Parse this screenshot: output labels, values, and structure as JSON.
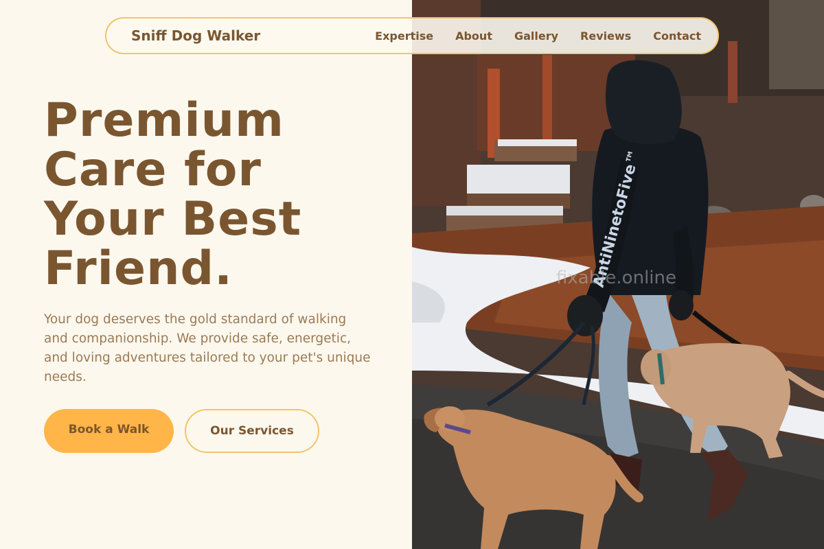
{
  "nav": {
    "brand": "Sniff Dog Walker",
    "links": [
      "Expertise",
      "About",
      "Gallery",
      "Reviews",
      "Contact"
    ]
  },
  "hero": {
    "headline_lines": [
      "Premium",
      "Care for",
      "Your Best",
      "Friend."
    ],
    "subtext": "Your dog deserves the gold standard of walking and companionship. We provide safe, energetic, and loving adventures tailored to your pet's unique needs.",
    "primary_button": "Book a Walk",
    "secondary_button": "Our Services"
  },
  "photo": {
    "hoodie_text": "AntiNinetoFive™",
    "watermark": "fixable.online"
  },
  "colors": {
    "brand_brown": "#7a5630",
    "accent_orange": "#ffb547",
    "border_gold": "#f2c46a",
    "background_cream": "#fdf8ee",
    "subtext_brown": "#9a7a55"
  }
}
